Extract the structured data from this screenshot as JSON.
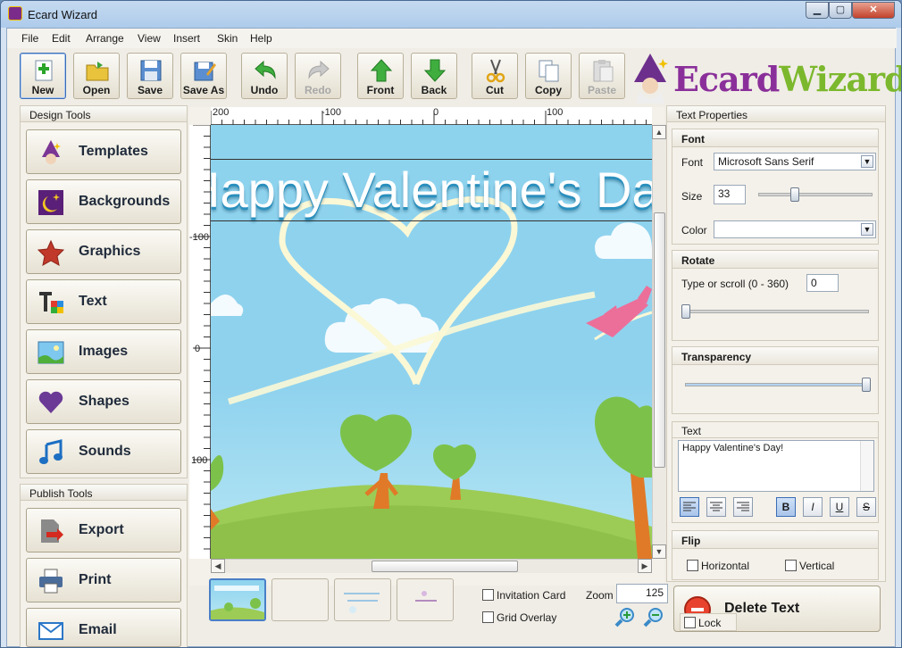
{
  "window": {
    "title": "Ecard Wizard",
    "min_glyph": "▁",
    "max_glyph": "▢",
    "close_glyph": "✕"
  },
  "menu": [
    "File",
    "Edit",
    "Arrange",
    "View",
    "Insert",
    "Skin",
    "Help"
  ],
  "toolbar": {
    "buttons": [
      {
        "id": "new",
        "label": "New",
        "icon": "new-icon"
      },
      {
        "id": "open",
        "label": "Open",
        "icon": "folder-open-icon"
      },
      {
        "id": "save",
        "label": "Save",
        "icon": "floppy-disk-icon"
      },
      {
        "id": "save-as",
        "label": "Save As",
        "icon": "save-as-icon"
      },
      {
        "id": "undo",
        "label": "Undo",
        "icon": "undo-arrow-icon"
      },
      {
        "id": "redo",
        "label": "Redo",
        "icon": "redo-arrow-icon",
        "disabled": true
      },
      {
        "id": "front",
        "label": "Front",
        "icon": "up-arrow-icon"
      },
      {
        "id": "back",
        "label": "Back",
        "icon": "down-arrow-icon"
      },
      {
        "id": "cut",
        "label": "Cut",
        "icon": "scissors-icon"
      },
      {
        "id": "copy",
        "label": "Copy",
        "icon": "copy-icon"
      },
      {
        "id": "paste",
        "label": "Paste",
        "icon": "paste-icon",
        "disabled": true
      }
    ],
    "logo": {
      "part1": "Ecard",
      "part2": "Wizard"
    }
  },
  "design_tools": {
    "header": "Design Tools",
    "items": [
      {
        "label": "Templates",
        "icon": "wizard-icon"
      },
      {
        "label": "Backgrounds",
        "icon": "moon-star-icon"
      },
      {
        "label": "Graphics",
        "icon": "star-icon"
      },
      {
        "label": "Text",
        "icon": "text-color-icon"
      },
      {
        "label": "Images",
        "icon": "picture-icon"
      },
      {
        "label": "Shapes",
        "icon": "heart-icon"
      },
      {
        "label": "Sounds",
        "icon": "music-note-icon"
      }
    ]
  },
  "publish_tools": {
    "header": "Publish Tools",
    "items": [
      {
        "label": "Export",
        "icon": "export-icon"
      },
      {
        "label": "Print",
        "icon": "printer-icon"
      },
      {
        "label": "Email",
        "icon": "envelope-icon"
      }
    ]
  },
  "canvas": {
    "headline": "Happy Valentine's Day!",
    "ruler_h": [
      "200",
      "-100",
      "0",
      "100"
    ],
    "ruler_v": [
      "-100",
      "0",
      "100"
    ],
    "colors": {
      "sky": "#8ed3ee",
      "grass": "#9ccc55",
      "tree_trunk": "#e07a28",
      "tree_leaf": "#7cc24a"
    }
  },
  "bottom": {
    "invitation_card": "Invitation Card",
    "grid_overlay": "Grid Overlay",
    "zoom_label": "Zoom",
    "zoom_value": "125",
    "thumbnail_count": 4
  },
  "text_properties": {
    "header": "Text Properties",
    "font": {
      "section": "Font",
      "font_label": "Font",
      "font_value": "Microsoft Sans Serif",
      "size_label": "Size",
      "size_value": "33",
      "color_label": "Color"
    },
    "rotate": {
      "section": "Rotate",
      "hint": "Type or scroll (0 - 360)",
      "value": "0"
    },
    "transparency": {
      "section": "Transparency"
    },
    "text": {
      "section": "Text",
      "value": "Happy Valentine's Day!"
    },
    "format_buttons": [
      "align-left",
      "align-center",
      "align-right",
      "bold",
      "italic",
      "underline",
      "strikethrough"
    ],
    "format_glyphs": {
      "bold": "B",
      "italic": "I",
      "underline": "U",
      "strikethrough": "S"
    },
    "flip": {
      "section": "Flip",
      "horizontal": "Horizontal",
      "vertical": "Vertical"
    },
    "delete_button": "Delete Text",
    "lock_label": "Lock"
  }
}
